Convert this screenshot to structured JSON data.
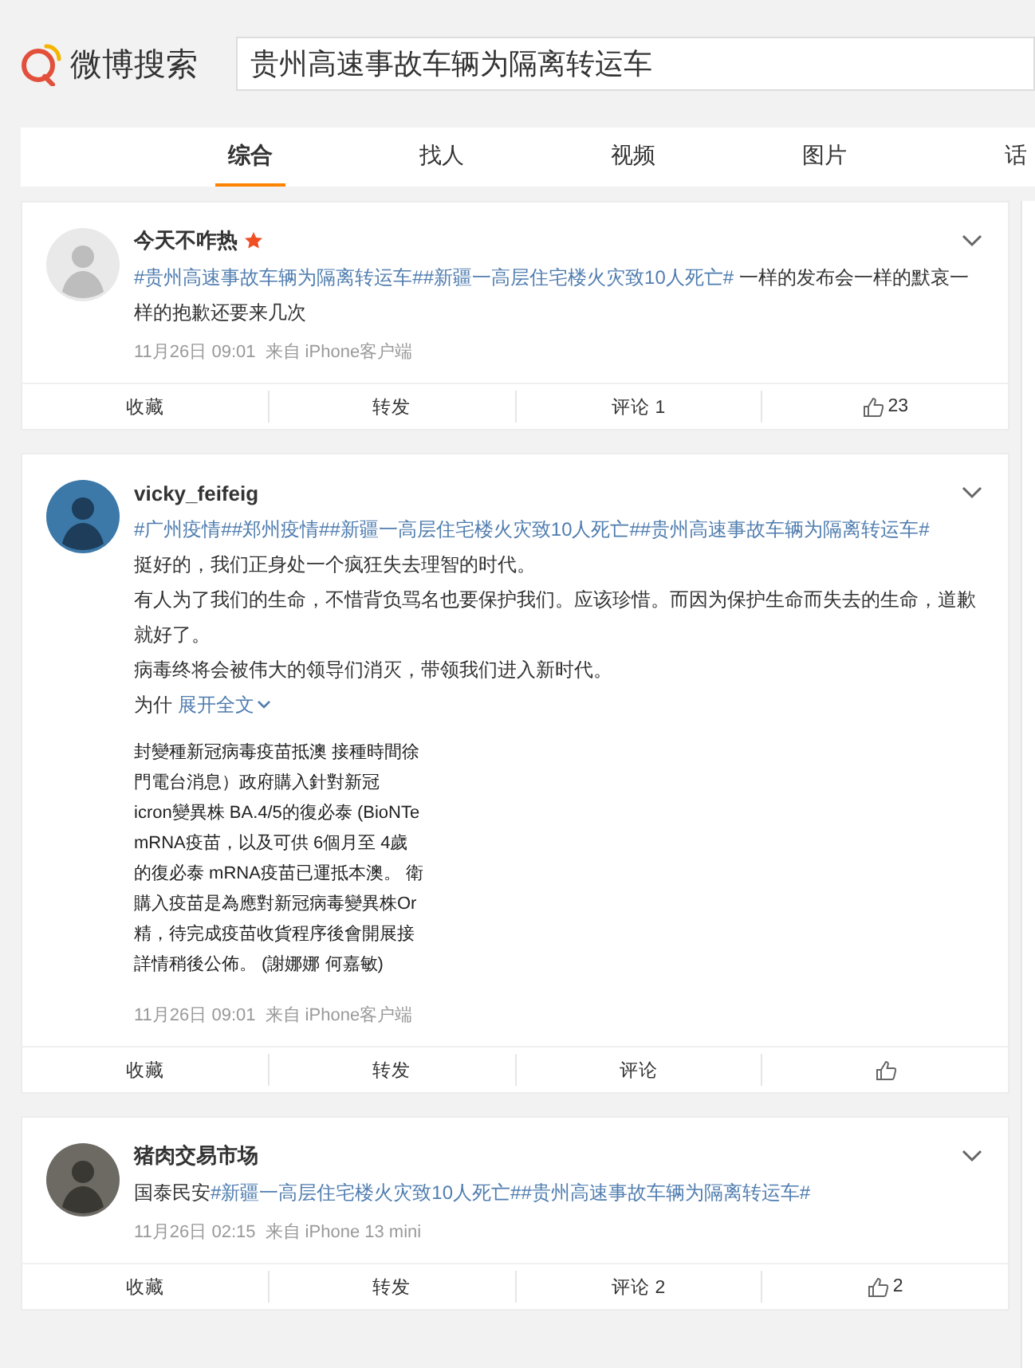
{
  "header": {
    "logo": "微博搜索",
    "search": {
      "value": "贵州高速事故车辆为隔离转运车"
    }
  },
  "tabs": [
    {
      "label": "综合",
      "selected": true
    },
    {
      "label": "找人",
      "selected": false
    },
    {
      "label": "视频",
      "selected": false
    },
    {
      "label": "图片",
      "selected": false
    },
    {
      "label": "话",
      "selected": false
    }
  ],
  "posts": [
    {
      "user": "今天不咋热",
      "badge": true,
      "body": [
        {
          "parts": [
            {
              "kind": "tag",
              "text": "#贵州高速事故车辆为隔离转运车#"
            },
            {
              "kind": "tag",
              "text": "#新疆一高层住宅楼火灾致10人死亡#"
            },
            {
              "kind": "text",
              "text": " 一样的发布会一样的默哀一样的抱歉还要来几次"
            }
          ]
        }
      ],
      "time": "11月26日 09:01",
      "source": "来自 iPhone客户端",
      "actions": [
        {
          "kind": "fav",
          "label": "收藏"
        },
        {
          "kind": "repost",
          "label": "转发"
        },
        {
          "kind": "comment",
          "label": "评论 1"
        },
        {
          "kind": "like",
          "label": "23"
        }
      ]
    },
    {
      "user": "vicky_feifeig",
      "badge": false,
      "body": [
        {
          "parts": [
            {
              "kind": "tag",
              "text": "#广州疫情#"
            },
            {
              "kind": "tag",
              "text": "#郑州疫情#"
            },
            {
              "kind": "tag",
              "text": "#新疆一高层住宅楼火灾致10人死亡#"
            },
            {
              "kind": "tag",
              "text": "#贵州高速事故车辆为隔离转运车#"
            }
          ]
        },
        {
          "parts": [
            {
              "kind": "text",
              "text": "挺好的，我们正身处一个疯狂失去理智的时代。"
            }
          ]
        },
        {
          "parts": [
            {
              "kind": "text",
              "text": "有人为了我们的生命，不惜背负骂名也要保护我们。应该珍惜。而因为保护生命而失去的生命，道歉就好了。"
            }
          ]
        },
        {
          "parts": [
            {
              "kind": "text",
              "text": "病毒终将会被伟大的领导们消灭，带领我们进入新时代。"
            }
          ]
        },
        {
          "parts": [
            {
              "kind": "text",
              "text": "为什 "
            },
            {
              "kind": "more",
              "text": "展开全文"
            }
          ]
        }
      ],
      "image_lines": [
        "封變種新冠病毒疫苗抵澳  接種時間徐",
        "門電台消息）政府購入針對新冠",
        "icron變異株 BA.4/5的復必泰 (BioNTe",
        "mRNA疫苗，以及可供 6個月至 4歲",
        "的復必泰 mRNA疫苗已運抵本澳。 衛",
        "購入疫苗是為應對新冠病毒變異株Or",
        "精，待完成疫苗收貨程序後會開展接",
        "詳情稍後公佈。 (謝娜娜  何嘉敏)"
      ],
      "time": "11月26日 09:01",
      "source": "来自 iPhone客户端",
      "actions": [
        {
          "kind": "fav",
          "label": "收藏"
        },
        {
          "kind": "repost",
          "label": "转发"
        },
        {
          "kind": "comment",
          "label": "评论"
        },
        {
          "kind": "like"
        }
      ]
    },
    {
      "user": "猪肉交易市场",
      "badge": false,
      "body": [
        {
          "parts": [
            {
              "kind": "text",
              "text": "国泰民安"
            },
            {
              "kind": "tag",
              "text": "#新疆一高层住宅楼火灾致10人死亡#"
            },
            {
              "kind": "tag",
              "text": "#贵州高速事故车辆为隔离转运车#"
            }
          ]
        }
      ],
      "time": "11月26日 02:15",
      "source": "来自 iPhone 13 mini",
      "actions": [
        {
          "kind": "fav",
          "label": "收藏"
        },
        {
          "kind": "repost",
          "label": "转发"
        },
        {
          "kind": "comment",
          "label": "评论 2"
        },
        {
          "kind": "like",
          "label": "2"
        }
      ]
    }
  ]
}
